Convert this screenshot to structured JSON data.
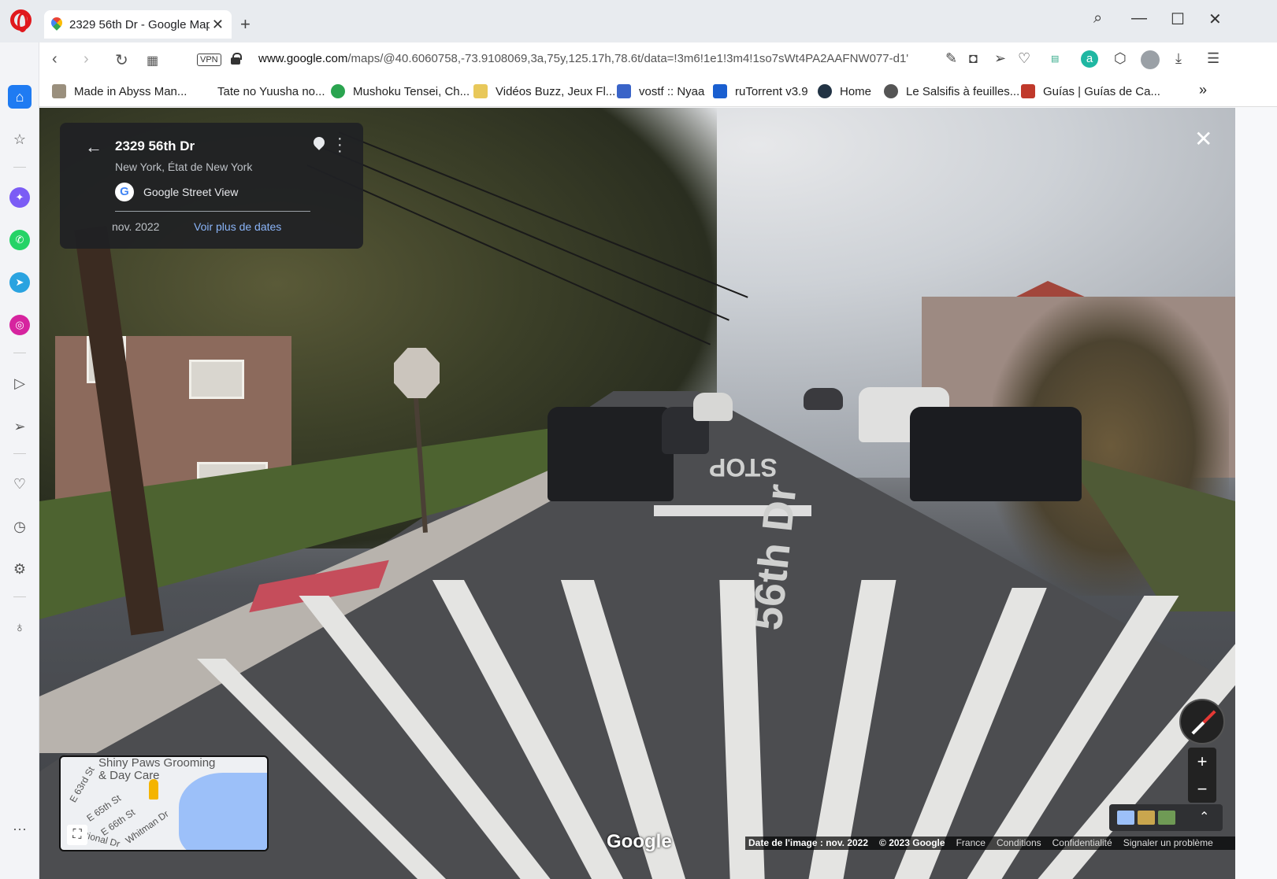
{
  "browser": {
    "tab_title": "2329 56th Dr - Google Maps",
    "url_host": "www.google.com",
    "url_path": "/maps/@40.6060758,-73.9108069,3a,75y,125.17h,78.6t/data=!3m6!1e1!3m4!1so7sWt4PA2AAFNW077-d1'",
    "vpn_label": "VPN",
    "new_tab_symbol": "+",
    "bookmarks": [
      {
        "label": "Made in Abyss Man...",
        "color": "#9a8f7d"
      },
      {
        "label": "Tate no Yuusha no...",
        "color": "#ffffff"
      },
      {
        "label": "Mushoku Tensei, Ch...",
        "color": "#2aa44f"
      },
      {
        "label": "Vidéos Buzz, Jeux Fl...",
        "color": "#e8c85a"
      },
      {
        "label": "vostf :: Nyaa",
        "color": "#3a64c8"
      },
      {
        "label": "ruTorrent v3.9",
        "color": "#1a5fd0"
      },
      {
        "label": "Home",
        "color": "#223344"
      },
      {
        "label": "Le Salsifis à feuilles...",
        "color": "#555555"
      },
      {
        "label": "Guías | Guías de Ca...",
        "color": "#c0392b"
      }
    ],
    "bookmarks_overflow": "»"
  },
  "sidebar": {
    "items": [
      {
        "name": "home-icon",
        "glyph": "⌂"
      },
      {
        "name": "star-icon",
        "glyph": "☆"
      },
      {
        "name": "messenger-icon",
        "glyph": "✦",
        "color": "#7b5cf5"
      },
      {
        "name": "whatsapp-icon",
        "glyph": "✆",
        "color": "#25d366"
      },
      {
        "name": "telegram-icon",
        "glyph": "➤",
        "color": "#2aa3e0"
      },
      {
        "name": "instagram-icon",
        "glyph": "◎",
        "color": "#d6249f"
      },
      {
        "name": "player-icon",
        "glyph": "▷"
      },
      {
        "name": "send-icon",
        "glyph": "➢"
      },
      {
        "name": "heart-icon",
        "glyph": "♡"
      },
      {
        "name": "history-icon",
        "glyph": "◷"
      },
      {
        "name": "settings-icon",
        "glyph": "⚙"
      },
      {
        "name": "bulb-icon",
        "glyph": "♁"
      },
      {
        "name": "more-icon",
        "glyph": "···"
      }
    ]
  },
  "streetview": {
    "address": "2329 56th Dr",
    "locality": "New York, État de New York",
    "provider": "Google Street View",
    "provider_logo": "G",
    "capture_date": "nov. 2022",
    "more_dates_link": "Voir plus de dates",
    "road_marking_stop": "STOP",
    "road_marking_street": "56th Dr",
    "watermark": "Google",
    "minimap": {
      "poi": "Shiny Paws Grooming\n& Day Care",
      "streets": [
        "E 63rd St",
        "E 65th St",
        "E 66th St",
        "Whitman Dr",
        "National Dr"
      ]
    },
    "zoom_in": "+",
    "zoom_out": "−",
    "footer": {
      "image_date": "Date de l'image : nov. 2022",
      "copyright": "© 2023 Google",
      "country": "France",
      "terms": "Conditions",
      "privacy": "Confidentialité",
      "report": "Signaler un problème"
    }
  }
}
